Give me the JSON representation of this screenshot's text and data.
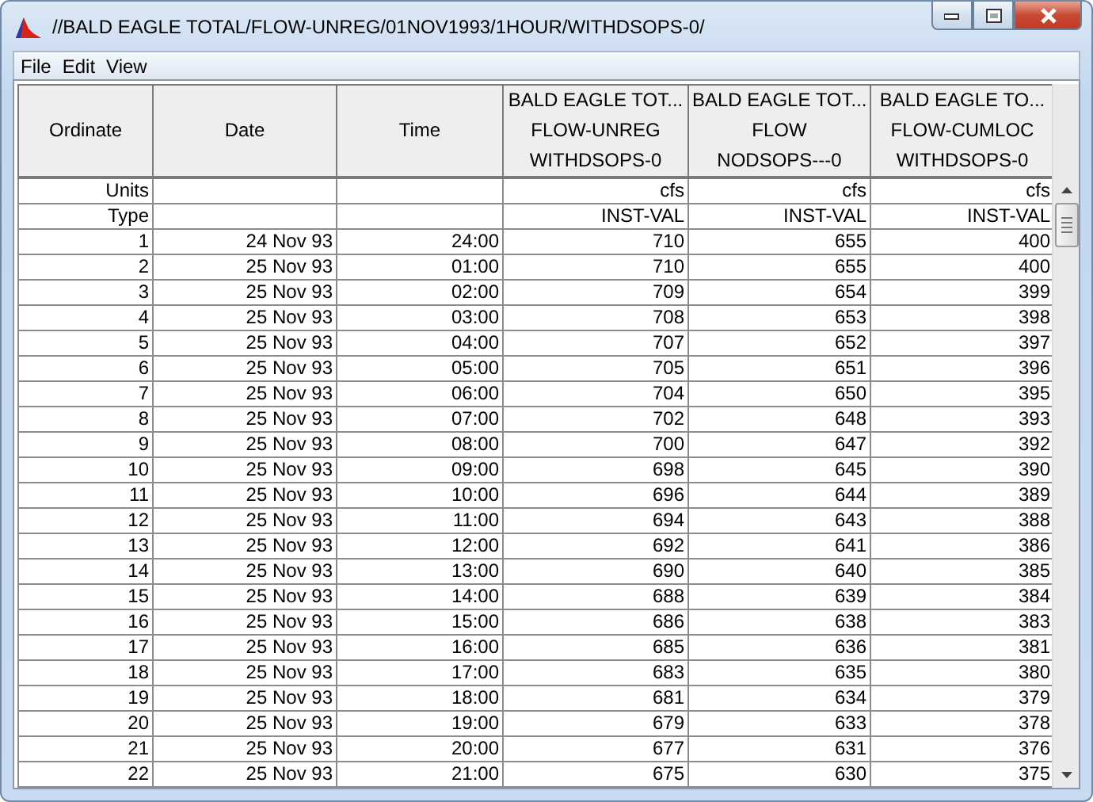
{
  "window": {
    "title": "//BALD EAGLE TOTAL/FLOW-UNREG/01NOV1993/1HOUR/WITHDSOPS-0/"
  },
  "menu": [
    "File",
    "Edit",
    "View"
  ],
  "table": {
    "columns": [
      {
        "lines": [
          "Ordinate"
        ]
      },
      {
        "lines": [
          "Date"
        ]
      },
      {
        "lines": [
          "Time"
        ]
      },
      {
        "lines": [
          "BALD EAGLE TOT...",
          "FLOW-UNREG",
          "WITHDSOPS-0"
        ]
      },
      {
        "lines": [
          "BALD EAGLE TOT...",
          "FLOW",
          "NODSOPS---0"
        ]
      },
      {
        "lines": [
          "BALD EAGLE TO...",
          "FLOW-CUMLOC",
          "WITHDSOPS-0"
        ]
      }
    ],
    "meta_rows": [
      {
        "label": "Units",
        "values": [
          "cfs",
          "cfs",
          "cfs"
        ]
      },
      {
        "label": "Type",
        "values": [
          "INST-VAL",
          "INST-VAL",
          "INST-VAL"
        ]
      }
    ],
    "rows": [
      {
        "ordinate": "1",
        "date": "24 Nov 93",
        "time": "24:00",
        "values": [
          "710",
          "655",
          "400"
        ]
      },
      {
        "ordinate": "2",
        "date": "25 Nov 93",
        "time": "01:00",
        "values": [
          "710",
          "655",
          "400"
        ]
      },
      {
        "ordinate": "3",
        "date": "25 Nov 93",
        "time": "02:00",
        "values": [
          "709",
          "654",
          "399"
        ]
      },
      {
        "ordinate": "4",
        "date": "25 Nov 93",
        "time": "03:00",
        "values": [
          "708",
          "653",
          "398"
        ]
      },
      {
        "ordinate": "5",
        "date": "25 Nov 93",
        "time": "04:00",
        "values": [
          "707",
          "652",
          "397"
        ]
      },
      {
        "ordinate": "6",
        "date": "25 Nov 93",
        "time": "05:00",
        "values": [
          "705",
          "651",
          "396"
        ]
      },
      {
        "ordinate": "7",
        "date": "25 Nov 93",
        "time": "06:00",
        "values": [
          "704",
          "650",
          "395"
        ]
      },
      {
        "ordinate": "8",
        "date": "25 Nov 93",
        "time": "07:00",
        "values": [
          "702",
          "648",
          "393"
        ]
      },
      {
        "ordinate": "9",
        "date": "25 Nov 93",
        "time": "08:00",
        "values": [
          "700",
          "647",
          "392"
        ]
      },
      {
        "ordinate": "10",
        "date": "25 Nov 93",
        "time": "09:00",
        "values": [
          "698",
          "645",
          "390"
        ]
      },
      {
        "ordinate": "11",
        "date": "25 Nov 93",
        "time": "10:00",
        "values": [
          "696",
          "644",
          "389"
        ]
      },
      {
        "ordinate": "12",
        "date": "25 Nov 93",
        "time": "11:00",
        "values": [
          "694",
          "643",
          "388"
        ]
      },
      {
        "ordinate": "13",
        "date": "25 Nov 93",
        "time": "12:00",
        "values": [
          "692",
          "641",
          "386"
        ]
      },
      {
        "ordinate": "14",
        "date": "25 Nov 93",
        "time": "13:00",
        "values": [
          "690",
          "640",
          "385"
        ]
      },
      {
        "ordinate": "15",
        "date": "25 Nov 93",
        "time": "14:00",
        "values": [
          "688",
          "639",
          "384"
        ]
      },
      {
        "ordinate": "16",
        "date": "25 Nov 93",
        "time": "15:00",
        "values": [
          "686",
          "638",
          "383"
        ]
      },
      {
        "ordinate": "17",
        "date": "25 Nov 93",
        "time": "16:00",
        "values": [
          "685",
          "636",
          "381"
        ]
      },
      {
        "ordinate": "18",
        "date": "25 Nov 93",
        "time": "17:00",
        "values": [
          "683",
          "635",
          "380"
        ]
      },
      {
        "ordinate": "19",
        "date": "25 Nov 93",
        "time": "18:00",
        "values": [
          "681",
          "634",
          "379"
        ]
      },
      {
        "ordinate": "20",
        "date": "25 Nov 93",
        "time": "19:00",
        "values": [
          "679",
          "633",
          "378"
        ]
      },
      {
        "ordinate": "21",
        "date": "25 Nov 93",
        "time": "20:00",
        "values": [
          "677",
          "631",
          "376"
        ]
      },
      {
        "ordinate": "22",
        "date": "25 Nov 93",
        "time": "21:00",
        "values": [
          "675",
          "630",
          "375"
        ]
      }
    ]
  }
}
